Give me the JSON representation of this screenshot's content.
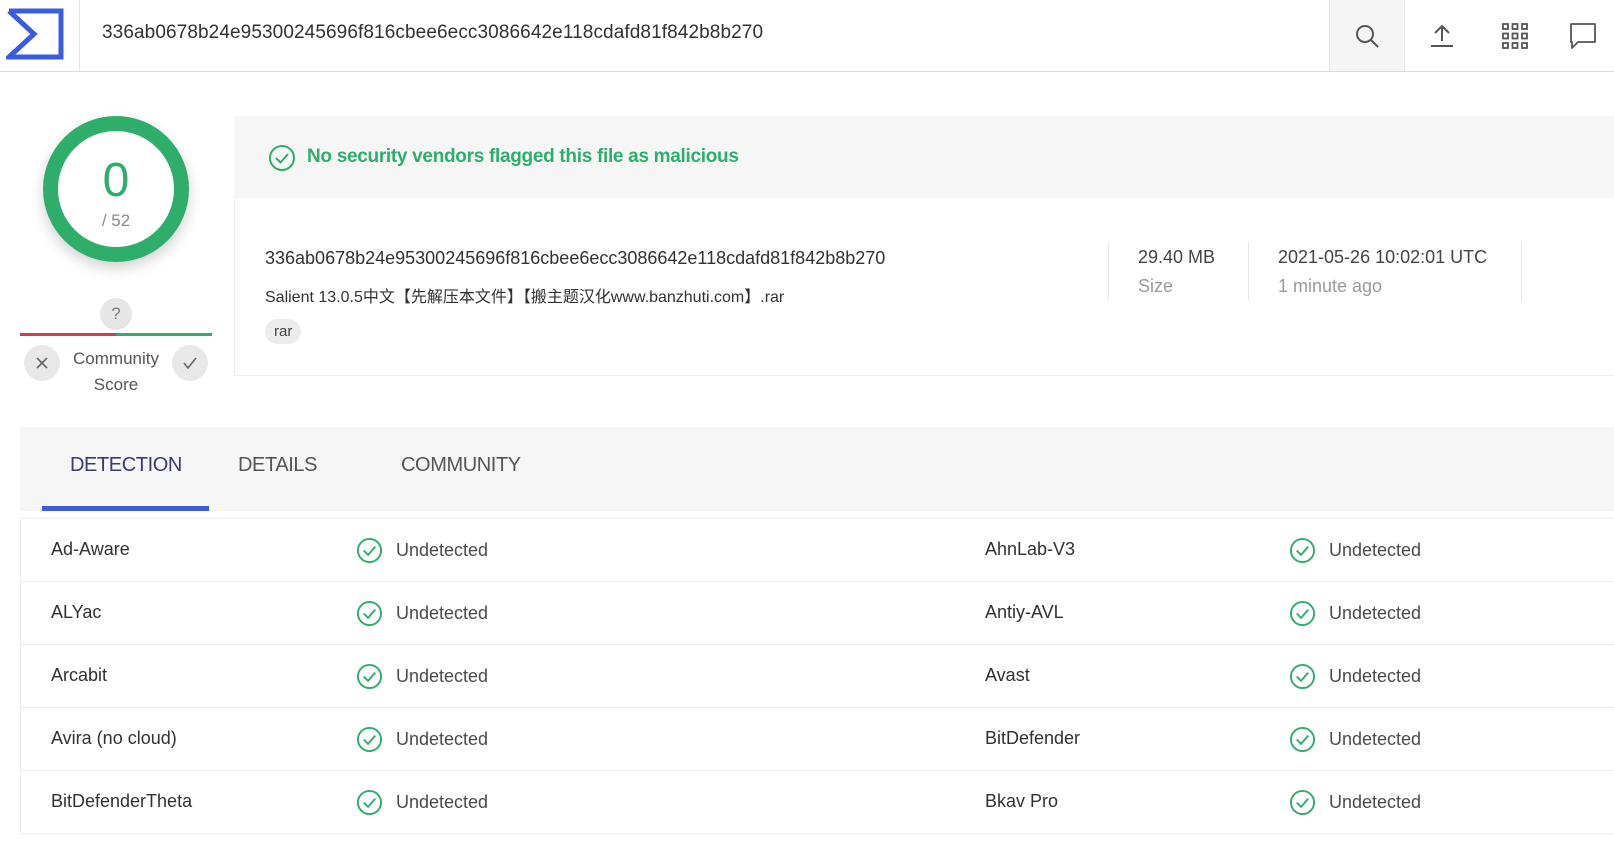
{
  "header": {
    "search_value": "336ab0678b24e95300245696f816cbee6ecc3086642e118cdafd81f842b8b270",
    "icons": [
      "virustotal-logo-icon",
      "search-icon",
      "upload-icon",
      "apps-grid-icon",
      "chat-icon"
    ]
  },
  "score": {
    "detected": "0",
    "total": "/ 52",
    "community_unknown": "?",
    "community_label": "Community Score"
  },
  "banner": {
    "message": "No security vendors flagged this file as malicious"
  },
  "file": {
    "hash": "336ab0678b24e95300245696f816cbee6ecc3086642e118cdafd81f842b8b270",
    "name": "Salient 13.0.5中文【先解压本文件】【搬主题汉化www.banzhuti.com】.rar",
    "tag": "rar",
    "size_value": "29.40 MB",
    "size_label": "Size",
    "date_value": "2021-05-26 10:02:01 UTC",
    "date_relative": "1 minute ago"
  },
  "tabs": [
    {
      "label": "DETECTION",
      "active": true
    },
    {
      "label": "DETAILS",
      "active": false
    },
    {
      "label": "COMMUNITY",
      "active": false
    }
  ],
  "detections": [
    {
      "left_vendor": "Ad-Aware",
      "left_status": "Undetected",
      "right_vendor": "AhnLab-V3",
      "right_status": "Undetected"
    },
    {
      "left_vendor": "ALYac",
      "left_status": "Undetected",
      "right_vendor": "Antiy-AVL",
      "right_status": "Undetected"
    },
    {
      "left_vendor": "Arcabit",
      "left_status": "Undetected",
      "right_vendor": "Avast",
      "right_status": "Undetected"
    },
    {
      "left_vendor": "Avira (no cloud)",
      "left_status": "Undetected",
      "right_vendor": "BitDefender",
      "right_status": "Undetected"
    },
    {
      "left_vendor": "BitDefenderTheta",
      "left_status": "Undetected",
      "right_vendor": "Bkav Pro",
      "right_status": "Undetected"
    }
  ],
  "colors": {
    "clean_green": "#2fae6b",
    "malicious_red": "#e5334d",
    "accent_blue": "#3b5cde"
  }
}
